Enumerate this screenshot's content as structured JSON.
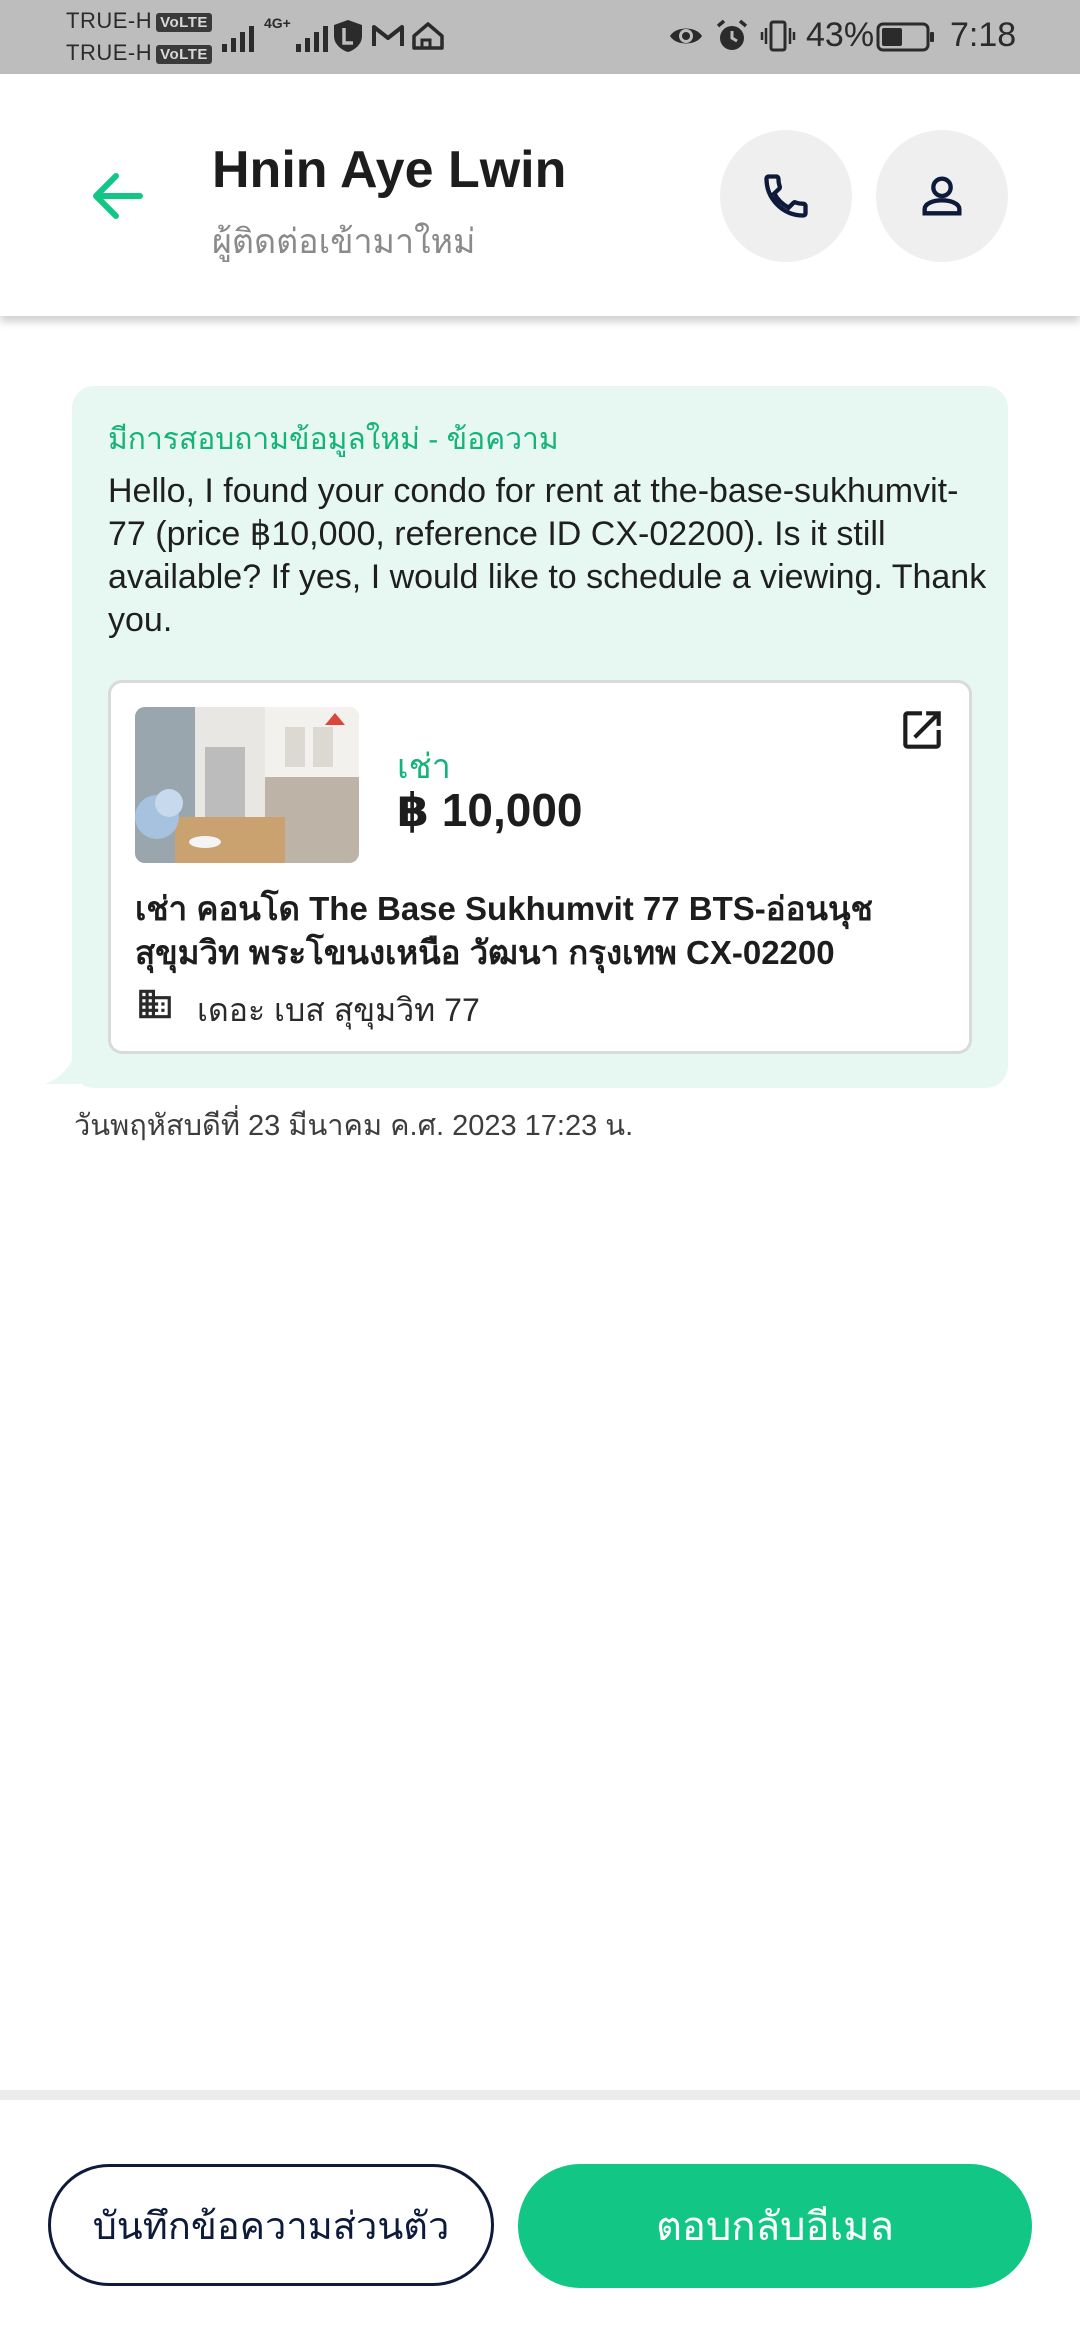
{
  "status_bar": {
    "sim1": "TRUE-H",
    "sim2": "TRUE-H",
    "volte": "VoLTE",
    "network": "4G+",
    "battery": "43%",
    "time": "7:18",
    "icons": [
      "signal-icon",
      "l-app-icon",
      "gmail-icon",
      "home-app-icon",
      "eye-icon",
      "alarm-icon",
      "vibrate-icon",
      "battery-icon"
    ]
  },
  "header": {
    "name": "Hnin Aye Lwin",
    "subtitle": "ผู้ติดต่อเข้ามาใหม่",
    "icons": [
      "arrow-left-icon",
      "phone-icon",
      "person-icon"
    ]
  },
  "message": {
    "title": "มีการสอบถามข้อมูลใหม่ - ข้อความ",
    "body": "Hello, I found your condo for rent at the-base-sukhumvit-77 (price ฿10,000, reference ID CX-02200). Is it still available? If yes, I would like to schedule a viewing. Thank you.",
    "timestamp": "วันพฤหัสบดีที่ 23 มีนาคม ค.ศ. 2023 17:23 น."
  },
  "listing": {
    "type_label": "เช่า",
    "price": "฿ 10,000",
    "title": "เช่า คอนโด  The Base Sukhumvit 77 BTS-อ่อนนุช สุขุมวิท พระโขนงเหนือ วัฒนา กรุงเทพ CX-02200",
    "building": "เดอะ เบส สุขุมวิท 77",
    "icons": [
      "external-link-icon",
      "building-icon"
    ]
  },
  "actions": {
    "note_label": "บันทึกข้อความส่วนตัว",
    "reply_label": "ตอบกลับอีเมล"
  },
  "colors": {
    "accent": "#12c785",
    "bubble": "#e6f8f1",
    "dark_text": "#0e1a3a"
  }
}
